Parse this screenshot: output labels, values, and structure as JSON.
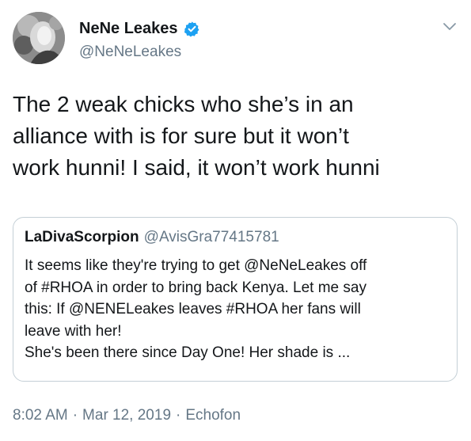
{
  "author": {
    "display_name": "NeNe Leakes",
    "handle": "@NeNeLeakes",
    "verified": true,
    "avatar_icon": "profile-photo",
    "menu_icon": "chevron-down-icon"
  },
  "tweet": {
    "text_lines": [
      "The 2 weak chicks who she’s in an",
      "alliance with is for sure but it won’t",
      "work hunni! I said, it won’t work hunni"
    ]
  },
  "quoted_tweet": {
    "display_name": "LaDivaScorpion",
    "handle": "@AvisGra77415781",
    "text_lines": [
      "It seems like they're trying to get @NeNeLeakes off",
      "of #RHOA in order to bring back Kenya. Let me say",
      "this: If @NENELeakes leaves #RHOA her fans will",
      "leave with her!",
      "She's been there since Day One! Her shade is ..."
    ]
  },
  "meta": {
    "time": "8:02 AM",
    "separator": "·",
    "date": "Mar 12, 2019",
    "source": "Echofon"
  },
  "colors": {
    "text": "#14171a",
    "secondary": "#657786",
    "border": "#c4cfd6",
    "verified_badge": "#1da1f2"
  }
}
